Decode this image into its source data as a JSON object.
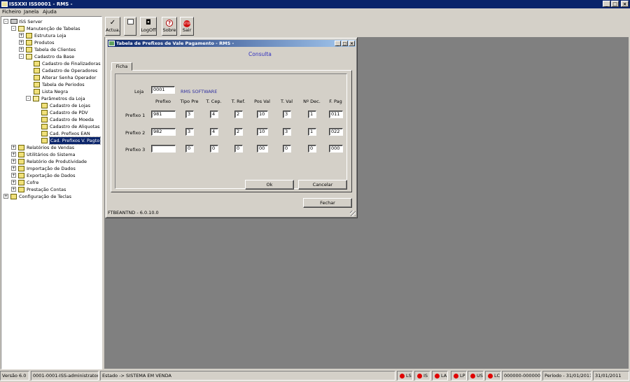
{
  "window": {
    "title": "ISSXXI ISS0001 - RMS -",
    "min": "_",
    "max": "□",
    "close": "×"
  },
  "menu": [
    "Ficheiro",
    "Janela",
    "Ajuda"
  ],
  "tree": [
    {
      "label": "ISS Server",
      "level": 0,
      "exp": "-",
      "icon": "server"
    },
    {
      "label": "Manutenção de Tabelas",
      "level": 1,
      "exp": "-",
      "icon": "folder-open"
    },
    {
      "label": "Estrutura Loja",
      "level": 2,
      "exp": "+",
      "icon": "folder"
    },
    {
      "label": "Produtos",
      "level": 2,
      "exp": "+",
      "icon": "folder"
    },
    {
      "label": "Tabela de Clientes",
      "level": 2,
      "exp": "+",
      "icon": "folder"
    },
    {
      "label": "Cadastro da Base",
      "level": 2,
      "exp": "-",
      "icon": "folder-open"
    },
    {
      "label": "Cadastro de Finalizadoras",
      "level": 3,
      "exp": "",
      "icon": "doc"
    },
    {
      "label": "Cadastro de Operadores",
      "level": 3,
      "exp": "",
      "icon": "doc"
    },
    {
      "label": "Alterar Senha Operador",
      "level": 3,
      "exp": "",
      "icon": "doc"
    },
    {
      "label": "Tabela de Periodos",
      "level": 3,
      "exp": "",
      "icon": "doc"
    },
    {
      "label": "Lista Negra",
      "level": 3,
      "exp": "",
      "icon": "doc"
    },
    {
      "label": "Parâmetros da Loja",
      "level": 3,
      "exp": "-",
      "icon": "folder-open",
      "offset": -1
    },
    {
      "label": "Cadastro de Lojas",
      "level": 4,
      "exp": "",
      "icon": "doc"
    },
    {
      "label": "Cadastro de PDV",
      "level": 4,
      "exp": "",
      "icon": "doc"
    },
    {
      "label": "Cadastro de Moeda",
      "level": 4,
      "exp": "",
      "icon": "doc"
    },
    {
      "label": "Cadastro de Aliquotas",
      "level": 4,
      "exp": "",
      "icon": "doc"
    },
    {
      "label": "Cad. Prefixos EAN",
      "level": 4,
      "exp": "",
      "icon": "doc"
    },
    {
      "label": "Cad. Prefixos V. Pagto",
      "level": 4,
      "exp": "",
      "icon": "doc",
      "selected": true
    },
    {
      "label": "Relatórios de Vendas",
      "level": 1,
      "exp": "+",
      "icon": "folder"
    },
    {
      "label": "Utilitários do Sistema",
      "level": 1,
      "exp": "+",
      "icon": "folder"
    },
    {
      "label": "Relatório de Produtividade",
      "level": 1,
      "exp": "+",
      "icon": "folder"
    },
    {
      "label": "Importação de Dados",
      "level": 1,
      "exp": "+",
      "icon": "folder"
    },
    {
      "label": "Exportação de Dados",
      "level": 1,
      "exp": "+",
      "icon": "folder"
    },
    {
      "label": "Cofre",
      "level": 1,
      "exp": "+",
      "icon": "folder"
    },
    {
      "label": "Prestação Contas",
      "level": 1,
      "exp": "+",
      "icon": "folder"
    },
    {
      "label": "Configuração de Teclas",
      "level": 0,
      "exp": "+",
      "icon": "folder"
    }
  ],
  "toolbar": {
    "actua": "Actua.",
    "blank": "",
    "logoff": "LogOff",
    "sobre": "Sobre",
    "sair": "Sair",
    "stop": "STOP"
  },
  "dialog": {
    "title": "Tabela de Prefixos de Vale Pagamento - RMS -",
    "mode": "Consulta",
    "tab": "Ficha",
    "loja_label": "Loja",
    "loja_value": "0001",
    "loja_name": "RMS SOFTWARE",
    "columns": [
      "Prefixo",
      "Tipo Pre",
      "T. Cep.",
      "T. Ref.",
      "Pos Val",
      "T. Val",
      "Nº Dec.",
      "F. Pag"
    ],
    "rows": [
      {
        "label": "Prefixo 1",
        "values": [
          "981",
          "3",
          "4",
          "2",
          "10",
          "3",
          "1",
          "011"
        ]
      },
      {
        "label": "Prefixo 2",
        "values": [
          "982",
          "3",
          "4",
          "2",
          "10",
          "3",
          "1",
          "022"
        ]
      },
      {
        "label": "Prefixo 3",
        "values": [
          "",
          "0",
          "0",
          "0",
          "00",
          "0",
          "0",
          "000"
        ]
      }
    ],
    "ok": "Ok",
    "cancel": "Cancelar",
    "close": "Fechar",
    "version": "FTBEANTND - 6.0.10.0"
  },
  "status": {
    "version": "Versão 6.0",
    "user": "0001-0001-ISS-administrator",
    "estado": "Estado -> SISTEMA EM VENDA",
    "leds": [
      "LS",
      "IS",
      "LA",
      "LP",
      "US",
      "LC"
    ],
    "code": "000000-000000",
    "periodo": "Período - 31/01/2011",
    "date": "31/01/2011",
    "led_color": "#e00000"
  }
}
